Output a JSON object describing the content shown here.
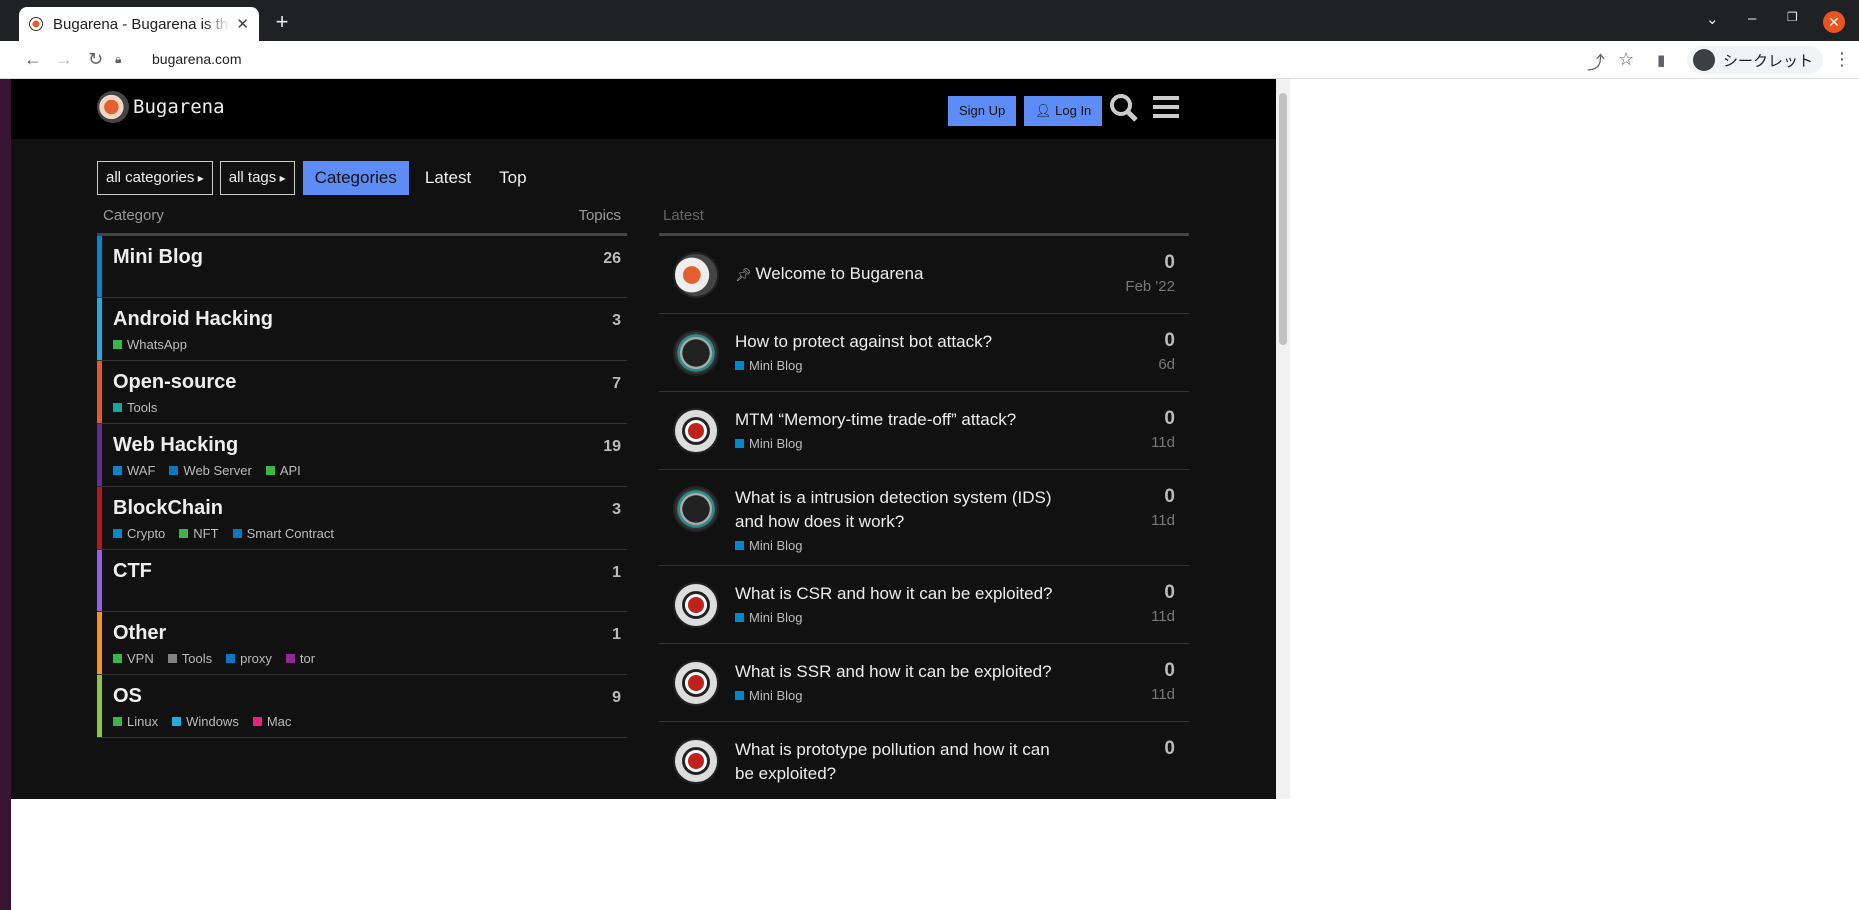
{
  "browser": {
    "tab_title": "Bugarena - Bugarena is the",
    "url": "bugarena.com",
    "incognito_label": "シークレット"
  },
  "header": {
    "site_name": "Bugarena",
    "signup_label": "Sign Up",
    "login_label": "Log In"
  },
  "filters": {
    "all_categories": "all categories",
    "all_tags": "all tags",
    "nav": [
      "Categories",
      "Latest",
      "Top"
    ]
  },
  "categories_table": {
    "col_category": "Category",
    "col_topics": "Topics",
    "rows": [
      {
        "name": "Mini Blog",
        "topics": "26",
        "color": "#0088cc",
        "subs": []
      },
      {
        "name": "Android Hacking",
        "topics": "3",
        "color": "#25aae2",
        "subs": [
          {
            "name": "WhatsApp",
            "color": "#3ab54a"
          }
        ]
      },
      {
        "name": "Open-source",
        "topics": "7",
        "color": "#e45735",
        "subs": [
          {
            "name": "Tools",
            "color": "#12a89d"
          }
        ]
      },
      {
        "name": "Web Hacking",
        "topics": "19",
        "color": "#652d90",
        "subs": [
          {
            "name": "WAF",
            "color": "#0088cc"
          },
          {
            "name": "Web Server",
            "color": "#0e76bd"
          },
          {
            "name": "API",
            "color": "#3ab54a"
          }
        ]
      },
      {
        "name": "BlockChain",
        "topics": "3",
        "color": "#b3191b",
        "subs": [
          {
            "name": "Crypto",
            "color": "#0088cc"
          },
          {
            "name": "NFT",
            "color": "#3ab54a"
          },
          {
            "name": "Smart Contract",
            "color": "#0e76bd"
          }
        ]
      },
      {
        "name": "CTF",
        "topics": "1",
        "color": "#9260e5",
        "subs": []
      },
      {
        "name": "Other",
        "topics": "1",
        "color": "#f7941d",
        "subs": [
          {
            "name": "VPN",
            "color": "#3ab54a"
          },
          {
            "name": "Tools",
            "color": "#808281"
          },
          {
            "name": "proxy",
            "color": "#0e76bd"
          },
          {
            "name": "tor",
            "color": "#92278f"
          }
        ]
      },
      {
        "name": "OS",
        "topics": "9",
        "color": "#8cc63f",
        "subs": [
          {
            "name": "Linux",
            "color": "#3ab54a"
          },
          {
            "name": "Windows",
            "color": "#25aae2"
          },
          {
            "name": "Mac",
            "color": "#ed207b"
          }
        ]
      }
    ]
  },
  "latest": {
    "heading": "Latest",
    "topics": [
      {
        "title": "Welcome to Bugarena",
        "pinned": true,
        "category": "",
        "replies": "0",
        "age": "Feb '22",
        "avatar": "logo2"
      },
      {
        "title": "How to protect against bot attack?",
        "pinned": false,
        "category": "Mini Blog",
        "replies": "0",
        "age": "6d",
        "avatar": "teal"
      },
      {
        "title": "MTM “Memory-time trade-off” attack?",
        "pinned": false,
        "category": "Mini Blog",
        "replies": "0",
        "age": "11d",
        "avatar": "red"
      },
      {
        "title": "What is a intrusion detection system (IDS) and how does it work?",
        "pinned": false,
        "category": "Mini Blog",
        "replies": "0",
        "age": "11d",
        "avatar": "teal"
      },
      {
        "title": "What is CSR and how it can be exploited?",
        "pinned": false,
        "category": "Mini Blog",
        "replies": "0",
        "age": "11d",
        "avatar": "red"
      },
      {
        "title": "What is SSR and how it can be exploited?",
        "pinned": false,
        "category": "Mini Blog",
        "replies": "0",
        "age": "11d",
        "avatar": "red"
      },
      {
        "title": "What is prototype pollution and how it can be exploited?",
        "pinned": false,
        "category": "",
        "replies": "0",
        "age": "",
        "avatar": "red"
      }
    ]
  }
}
